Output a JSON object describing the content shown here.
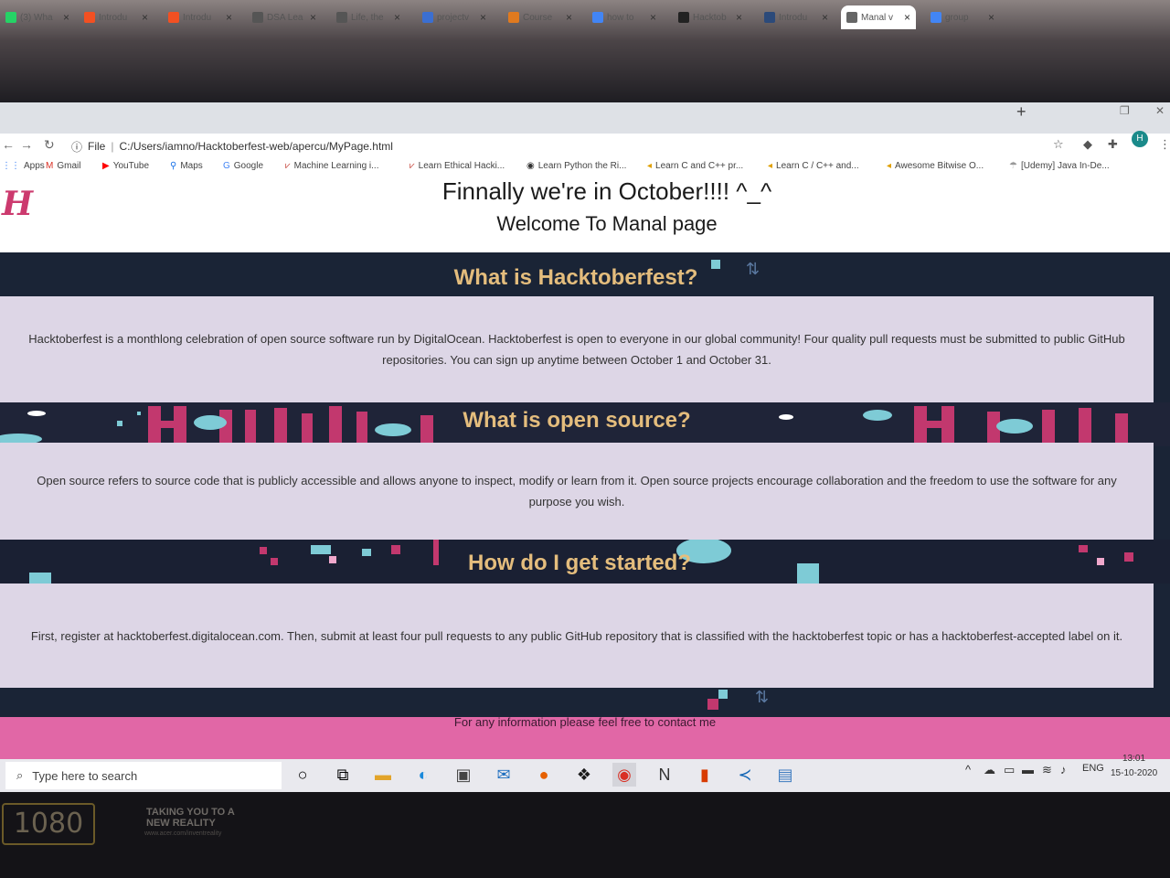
{
  "browser": {
    "tabs": [
      {
        "label": "(3) Wha",
        "icon": "whatsapp-icon"
      },
      {
        "label": "Introdu",
        "icon": "microsoft-icon"
      },
      {
        "label": "Introdu",
        "icon": "microsoft-icon"
      },
      {
        "label": "DSA Lea",
        "icon": "cc-icon"
      },
      {
        "label": "Life, the",
        "icon": "cc-icon"
      },
      {
        "label": "projectv",
        "icon": "shield-icon"
      },
      {
        "label": "Course",
        "icon": "course-icon"
      },
      {
        "label": "how to",
        "icon": "google-icon"
      },
      {
        "label": "Hacktob",
        "icon": "github-icon"
      },
      {
        "label": "Introdu",
        "icon": "b-icon"
      },
      {
        "label": "Manal v",
        "icon": "globe-icon"
      },
      {
        "label": "group",
        "icon": "google-icon"
      }
    ],
    "new_tab": "+",
    "address": {
      "scheme": "File",
      "url": "C:/Users/iamno/Hacktoberfest-web/apercu/MyPage.html"
    },
    "profile_initial": "H",
    "bookmarks": [
      "Apps",
      "Gmail",
      "YouTube",
      "Maps",
      "Google",
      "Machine Learning i...",
      "Learn Ethical Hacki...",
      "Learn Python the Ri...",
      "Learn C and C++ pr...",
      "Learn C / C++ and...",
      "Awesome Bitwise O...",
      "[Udemy] Java In-De..."
    ]
  },
  "page": {
    "logo": "H",
    "title": "Finnally we're in October!!!! ^_^",
    "subtitle": "Welcome To Manal page",
    "sections": [
      {
        "title": "What is Hacktoberfest?",
        "body": "Hacktoberfest is a monthlong celebration of open source software run by DigitalOcean. Hacktoberfest is open to everyone in our global community! Four quality pull requests must be submitted to public GitHub repositories. You can sign up anytime between October 1 and October 31."
      },
      {
        "title": "What is open source?",
        "body": "Open source refers to source code that is publicly accessible and allows anyone to inspect, modify or learn from it. Open source projects encourage collaboration and the freedom to use the software for any purpose you wish."
      },
      {
        "title": "How do I get started?",
        "body": "First, register at hacktoberfest.digitalocean.com. Then, submit at least four pull requests to any public GitHub repository that is classified with the hacktoberfest topic or has a hacktoberfest-accepted label on it."
      }
    ],
    "footer": "For any information please feel free to contact me"
  },
  "taskbar": {
    "search_placeholder": "Type here to search",
    "language": "ENG",
    "time": "13:01",
    "date": "15-10-2020"
  },
  "monitor": {
    "badge": "1080",
    "slogan": "TAKING YOU TO A NEW REALITY",
    "url": "www.acer.com/inventreality"
  },
  "colors": {
    "page_bg": "#1a2436",
    "section_title": "#e4bd7d",
    "card_bg": "#ddd6e6",
    "footer_bg": "#e167a6",
    "accent_pink": "#cc3a6e",
    "accent_teal": "#7ecbd6"
  }
}
